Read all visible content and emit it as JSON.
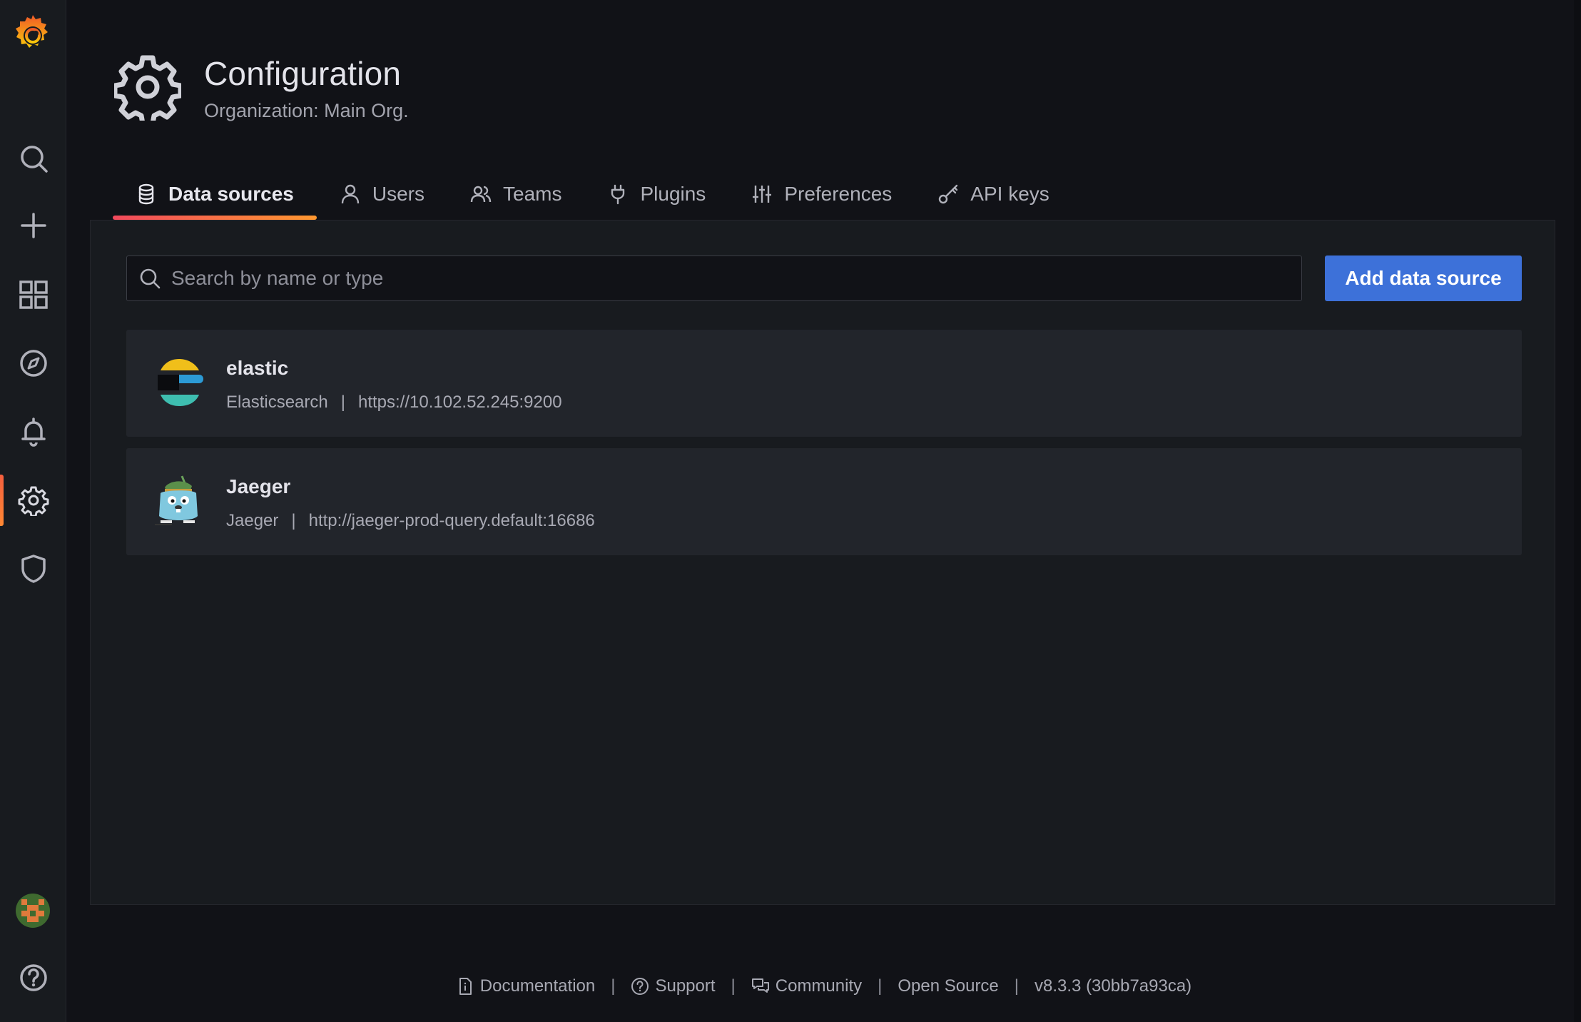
{
  "sidebar": {
    "logo": "grafana-logo-icon",
    "items": [
      {
        "name": "search",
        "icon": "search-icon"
      },
      {
        "name": "create",
        "icon": "plus-icon"
      },
      {
        "name": "dashboards",
        "icon": "apps-icon"
      },
      {
        "name": "explore",
        "icon": "compass-icon"
      },
      {
        "name": "alerting",
        "icon": "bell-icon"
      },
      {
        "name": "configuration",
        "icon": "gear-icon",
        "active": true
      },
      {
        "name": "server-admin",
        "icon": "shield-icon"
      }
    ],
    "bottom": [
      {
        "name": "profile",
        "icon": "avatar"
      },
      {
        "name": "help",
        "icon": "question-circle-icon"
      }
    ]
  },
  "header": {
    "title": "Configuration",
    "subtitle": "Organization: Main Org."
  },
  "tabs": [
    {
      "label": "Data sources",
      "icon": "database-icon",
      "active": true
    },
    {
      "label": "Users",
      "icon": "user-icon"
    },
    {
      "label": "Teams",
      "icon": "users-icon"
    },
    {
      "label": "Plugins",
      "icon": "plug-icon"
    },
    {
      "label": "Preferences",
      "icon": "sliders-icon"
    },
    {
      "label": "API keys",
      "icon": "key-icon"
    }
  ],
  "search": {
    "placeholder": "Search by name or type",
    "value": ""
  },
  "add_button": "Add data source",
  "datasources": [
    {
      "name": "elastic",
      "type": "Elasticsearch",
      "url": "https://10.102.52.245:9200",
      "logo": "elasticsearch-logo"
    },
    {
      "name": "Jaeger",
      "type": "Jaeger",
      "url": "http://jaeger-prod-query.default:16686",
      "logo": "jaeger-logo"
    }
  ],
  "footer": {
    "documentation": "Documentation",
    "support": "Support",
    "community": "Community",
    "open_source": "Open Source",
    "version": "v8.3.3 (30bb7a93ca)",
    "separator": "|"
  },
  "colors": {
    "accent_gradient_start": "#f2495c",
    "accent_gradient_end": "#ff9830",
    "primary_button": "#3d71d9",
    "background": "#111217",
    "panel": "#181b1f",
    "card": "#22252b"
  }
}
